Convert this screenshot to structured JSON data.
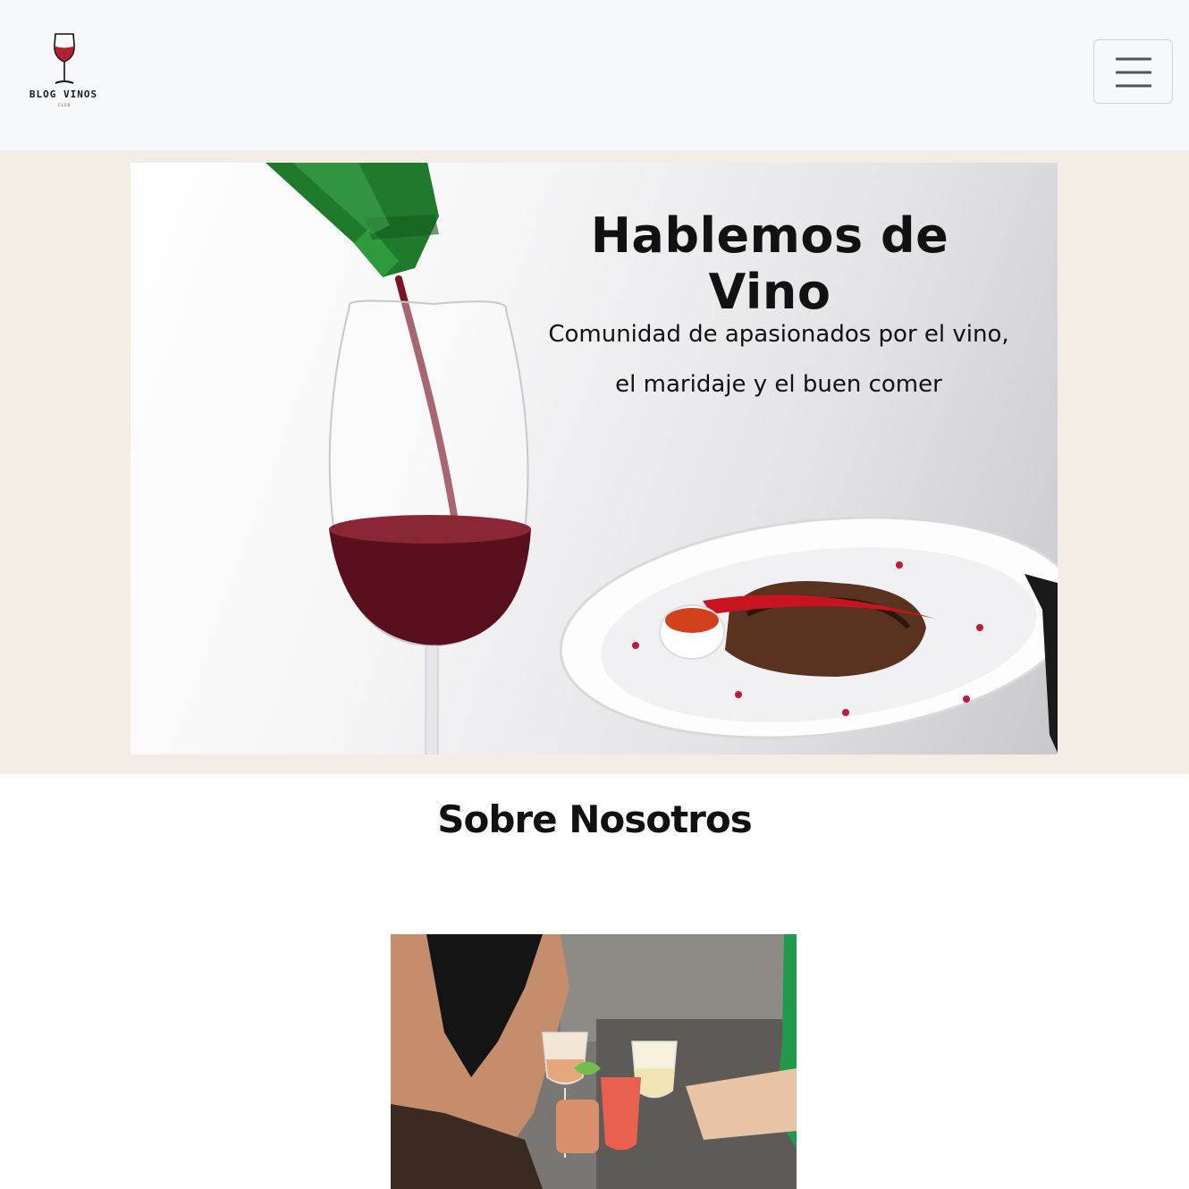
{
  "navbar": {
    "brand_name": "BLOG VINOS",
    "brand_tagline": "CLUB",
    "logo_icon": "wine-glass-icon",
    "menu_icon": "hamburger-menu-icon"
  },
  "hero": {
    "title": "Hablemos de Vino",
    "subtitle_line1": "Comunidad de apasionados por el vino,",
    "subtitle_line2": "el maridaje y el buen comer",
    "background_color": "#f4ede5"
  },
  "about": {
    "title": "Sobre Nosotros"
  },
  "colors": {
    "navbar_bg": "#f7f8fa",
    "wine_red": "#7a1624",
    "bottle_green": "#1f7a2c"
  }
}
